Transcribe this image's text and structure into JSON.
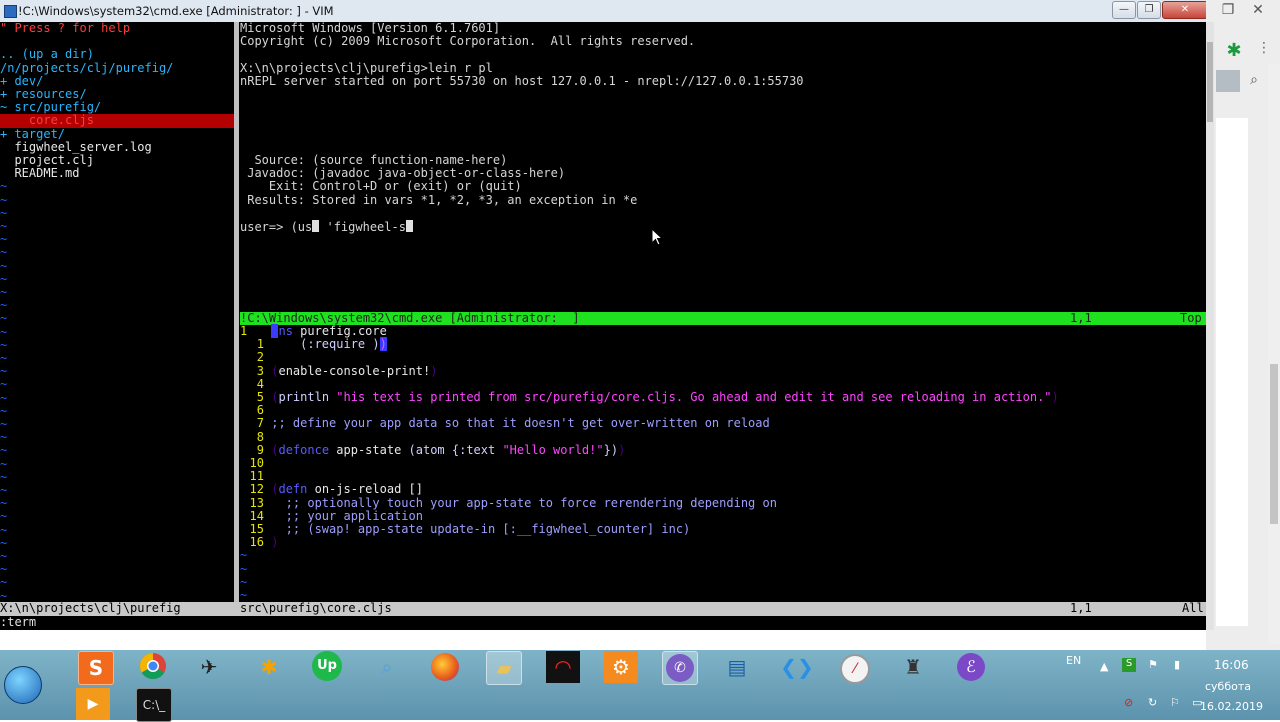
{
  "window": {
    "title": "!C:\\Windows\\system32\\cmd.exe [Administrator: ] - VIM",
    "minimize_label": "—",
    "maximize_label": "❐",
    "close_label": "✕"
  },
  "tree": {
    "help": "\" Press ? for help",
    "items": [
      {
        "label": ".. (up a dir)"
      },
      {
        "label": "/n/projects/clj/purefig/"
      },
      {
        "label": "+ dev/"
      },
      {
        "label": "+ resources/"
      },
      {
        "label": "~ src/purefig/"
      },
      {
        "label": "    core.cljs"
      },
      {
        "label": "+ target/"
      },
      {
        "label": "  figwheel_server.log"
      },
      {
        "label": "  project.clj"
      },
      {
        "label": "  README.md"
      }
    ]
  },
  "terminal": {
    "lines": [
      "Microsoft Windows [Version 6.1.7601]",
      "Copyright (c) 2009 Microsoft Corporation.  All rights reserved.",
      "",
      "X:\\n\\projects\\clj\\purefig>lein r pl",
      "nREPL server started on port 55730 on host 127.0.0.1 - nrepl://127.0.0.1:55730",
      "",
      "",
      "",
      "",
      "",
      "  Source: (source function-name-here)",
      " Javadoc: (javadoc java-object-or-class-here)",
      "    Exit: Control+D or (exit) or (quit)",
      " Results: Stored in vars *1, *2, *3, an exception in *e",
      "",
      "user=> (us"
    ],
    "prompt_tail": " 'figwheel-s"
  },
  "split_status": {
    "name": "!C:\\Windows\\system32\\cmd.exe [Administrator:  ]",
    "position": "1,1",
    "scroll": "Top"
  },
  "code": {
    "ln1": "1",
    "ln2": "1",
    "ln3": "2",
    "ln4": "3",
    "ln5": "4",
    "ln6": "5",
    "ln7": "6",
    "ln8": "7",
    "ln9": "8",
    "ln10": "9",
    "ln11": "10",
    "ln12": "11",
    "ln13": "12",
    "ln14": "13",
    "ln15": "14",
    "ln16": "15",
    "ln17": "16",
    "ns": "ns",
    "ns_name": " purefig.core",
    "require": "(:require )",
    "enable": "enable-console-print!",
    "println": "println",
    "println_str": "\"his text is printed from src/purefig/core.cljs. Go ahead and edit it and see reloading in action.\"",
    "comment1": ";; define your app data so that it doesn't get over-written on reload",
    "defonce": "defonce",
    "appstate": " app-state ",
    "atom": "(atom {:text ",
    "hello": "\"Hello world!\"",
    "atom_close": "})",
    "defn": "defn",
    "onjs": " on-js-reload []",
    "c1": "  ;; optionally touch your app-state to force rerendering depending on",
    "c2": "  ;; your application",
    "c3": "  ;; (swap! app-state update-in [:__figwheel_counter] inc)",
    "close": ")"
  },
  "status": {
    "tree_path": "X:\\n\\projects\\clj\\purefig",
    "file": "src\\purefig\\core.cljs",
    "position": "1,1",
    "scroll": "All"
  },
  "cmdline": ":term",
  "tray": {
    "lang": "EN",
    "time": "16:06",
    "day": "суббота",
    "date": "16.02.2019"
  }
}
